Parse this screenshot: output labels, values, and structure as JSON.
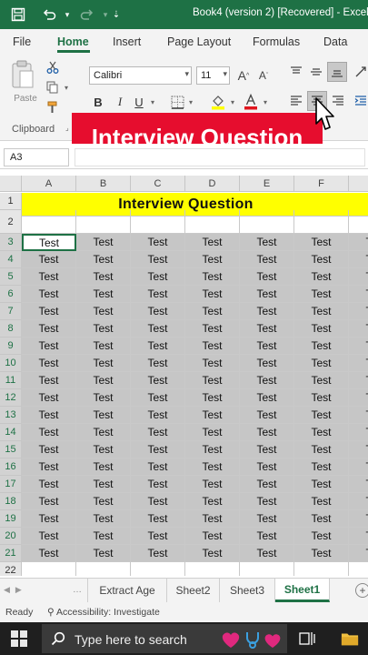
{
  "window": {
    "title": "Book4 (version 2) [Recovered]  -  Excel"
  },
  "ribbon": {
    "tabs": [
      "File",
      "Home",
      "Insert",
      "Page Layout",
      "Formulas",
      "Data"
    ],
    "active_tab": "Home",
    "paste_label": "Paste",
    "font_name": "Calibri",
    "font_size": "11",
    "bold_label": "B",
    "italic_label": "I",
    "underline_label": "U",
    "clipboard_group_label": "Clipboard"
  },
  "overlay": {
    "banner_text": "Interview Question"
  },
  "formula_bar": {
    "name_box": "A3"
  },
  "sheet": {
    "column_headers": [
      "A",
      "B",
      "C",
      "D",
      "E",
      "F"
    ],
    "row_numbers": [
      "1",
      "2",
      "3",
      "4",
      "5",
      "6",
      "7",
      "8",
      "9",
      "10",
      "11",
      "12",
      "13",
      "14",
      "15",
      "16",
      "17",
      "18",
      "19",
      "20",
      "21",
      "22"
    ],
    "title_cell_text": "Interview  Question",
    "cell_value": "Test",
    "selected_range": "A3:G21",
    "active_cell": "A3"
  },
  "sheet_tabs": {
    "tabs": [
      "Extract Age",
      "Sheet2",
      "Sheet3",
      "Sheet1"
    ],
    "active": "Sheet1"
  },
  "status_bar": {
    "ready": "Ready",
    "accessibility": "Accessibility: Investigate"
  },
  "taskbar": {
    "search_placeholder": "Type here to search"
  },
  "colors": {
    "excel_green": "#1e7145",
    "banner_red": "#e60d2e",
    "title_yellow": "#ffff00",
    "selection_gray": "#c6c6c6"
  }
}
